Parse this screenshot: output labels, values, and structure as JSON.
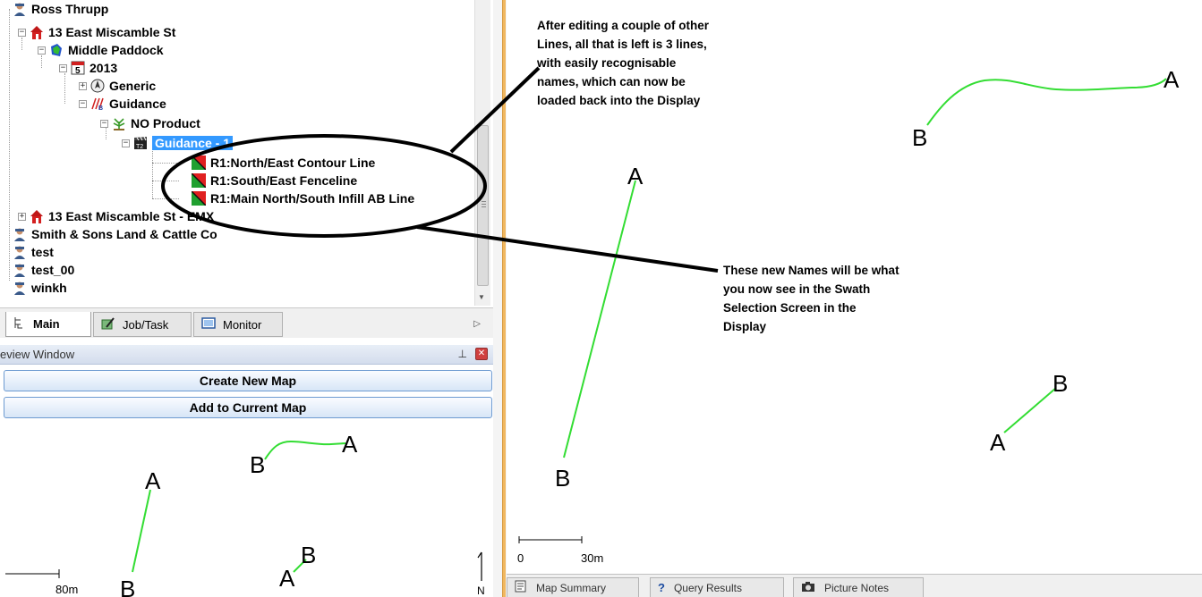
{
  "tree": {
    "nodes": [
      {
        "label": "Ross Thrupp",
        "icon": "person-icon"
      },
      {
        "label": "13 East Miscamble St",
        "icon": "farm-icon"
      },
      {
        "label": "Middle Paddock",
        "icon": "paddock-icon"
      },
      {
        "label": "2013",
        "icon": "calendar-icon"
      },
      {
        "label": "Generic",
        "icon": "compass-icon"
      },
      {
        "label": "Guidance",
        "icon": "guidance-icon"
      },
      {
        "label": "NO Product",
        "icon": "plant-icon"
      },
      {
        "label": "Guidance - 1",
        "icon": "clapper-icon"
      },
      {
        "label": "R1:North/East Contour Line",
        "icon": "line-icon"
      },
      {
        "label": "R1:South/East Fenceline",
        "icon": "line-icon"
      },
      {
        "label": "R1:Main North/South Infill AB Line",
        "icon": "line-icon"
      },
      {
        "label": "13 East Miscamble St - EMX",
        "icon": "farm-icon"
      },
      {
        "label": "Smith & Sons Land & Cattle Co",
        "icon": "person-icon"
      },
      {
        "label": "test",
        "icon": "person-icon"
      },
      {
        "label": "test_00",
        "icon": "person-icon"
      },
      {
        "label": "winkh",
        "icon": "person-icon"
      }
    ]
  },
  "tabs": [
    {
      "label": "Main"
    },
    {
      "label": "Job/Task"
    },
    {
      "label": "Monitor"
    }
  ],
  "preview": {
    "title": "eview Window",
    "create_button": "Create New Map",
    "add_button": "Add to Current Map"
  },
  "mini_map": {
    "scale_label": "80m",
    "north_label": "N"
  },
  "main_map": {
    "scale_left": "0",
    "scale_right": "30m"
  },
  "callouts": {
    "first": "After editing a couple of other Lines, all that is left is 3 lines, with easily recognisable names, which can now be loaded back into the Display",
    "second": "These new Names will be what you now see in the Swath Selection Screen in the Display"
  },
  "line_labels": {
    "a": "A",
    "b": "B"
  },
  "status_tabs": [
    {
      "label": "Map Summary"
    },
    {
      "label": "Query Results"
    },
    {
      "label": "Picture Notes"
    }
  ],
  "colors": {
    "swath_line": "#33dd33",
    "selection": "#3399ff",
    "splitter": "#f0b760"
  }
}
